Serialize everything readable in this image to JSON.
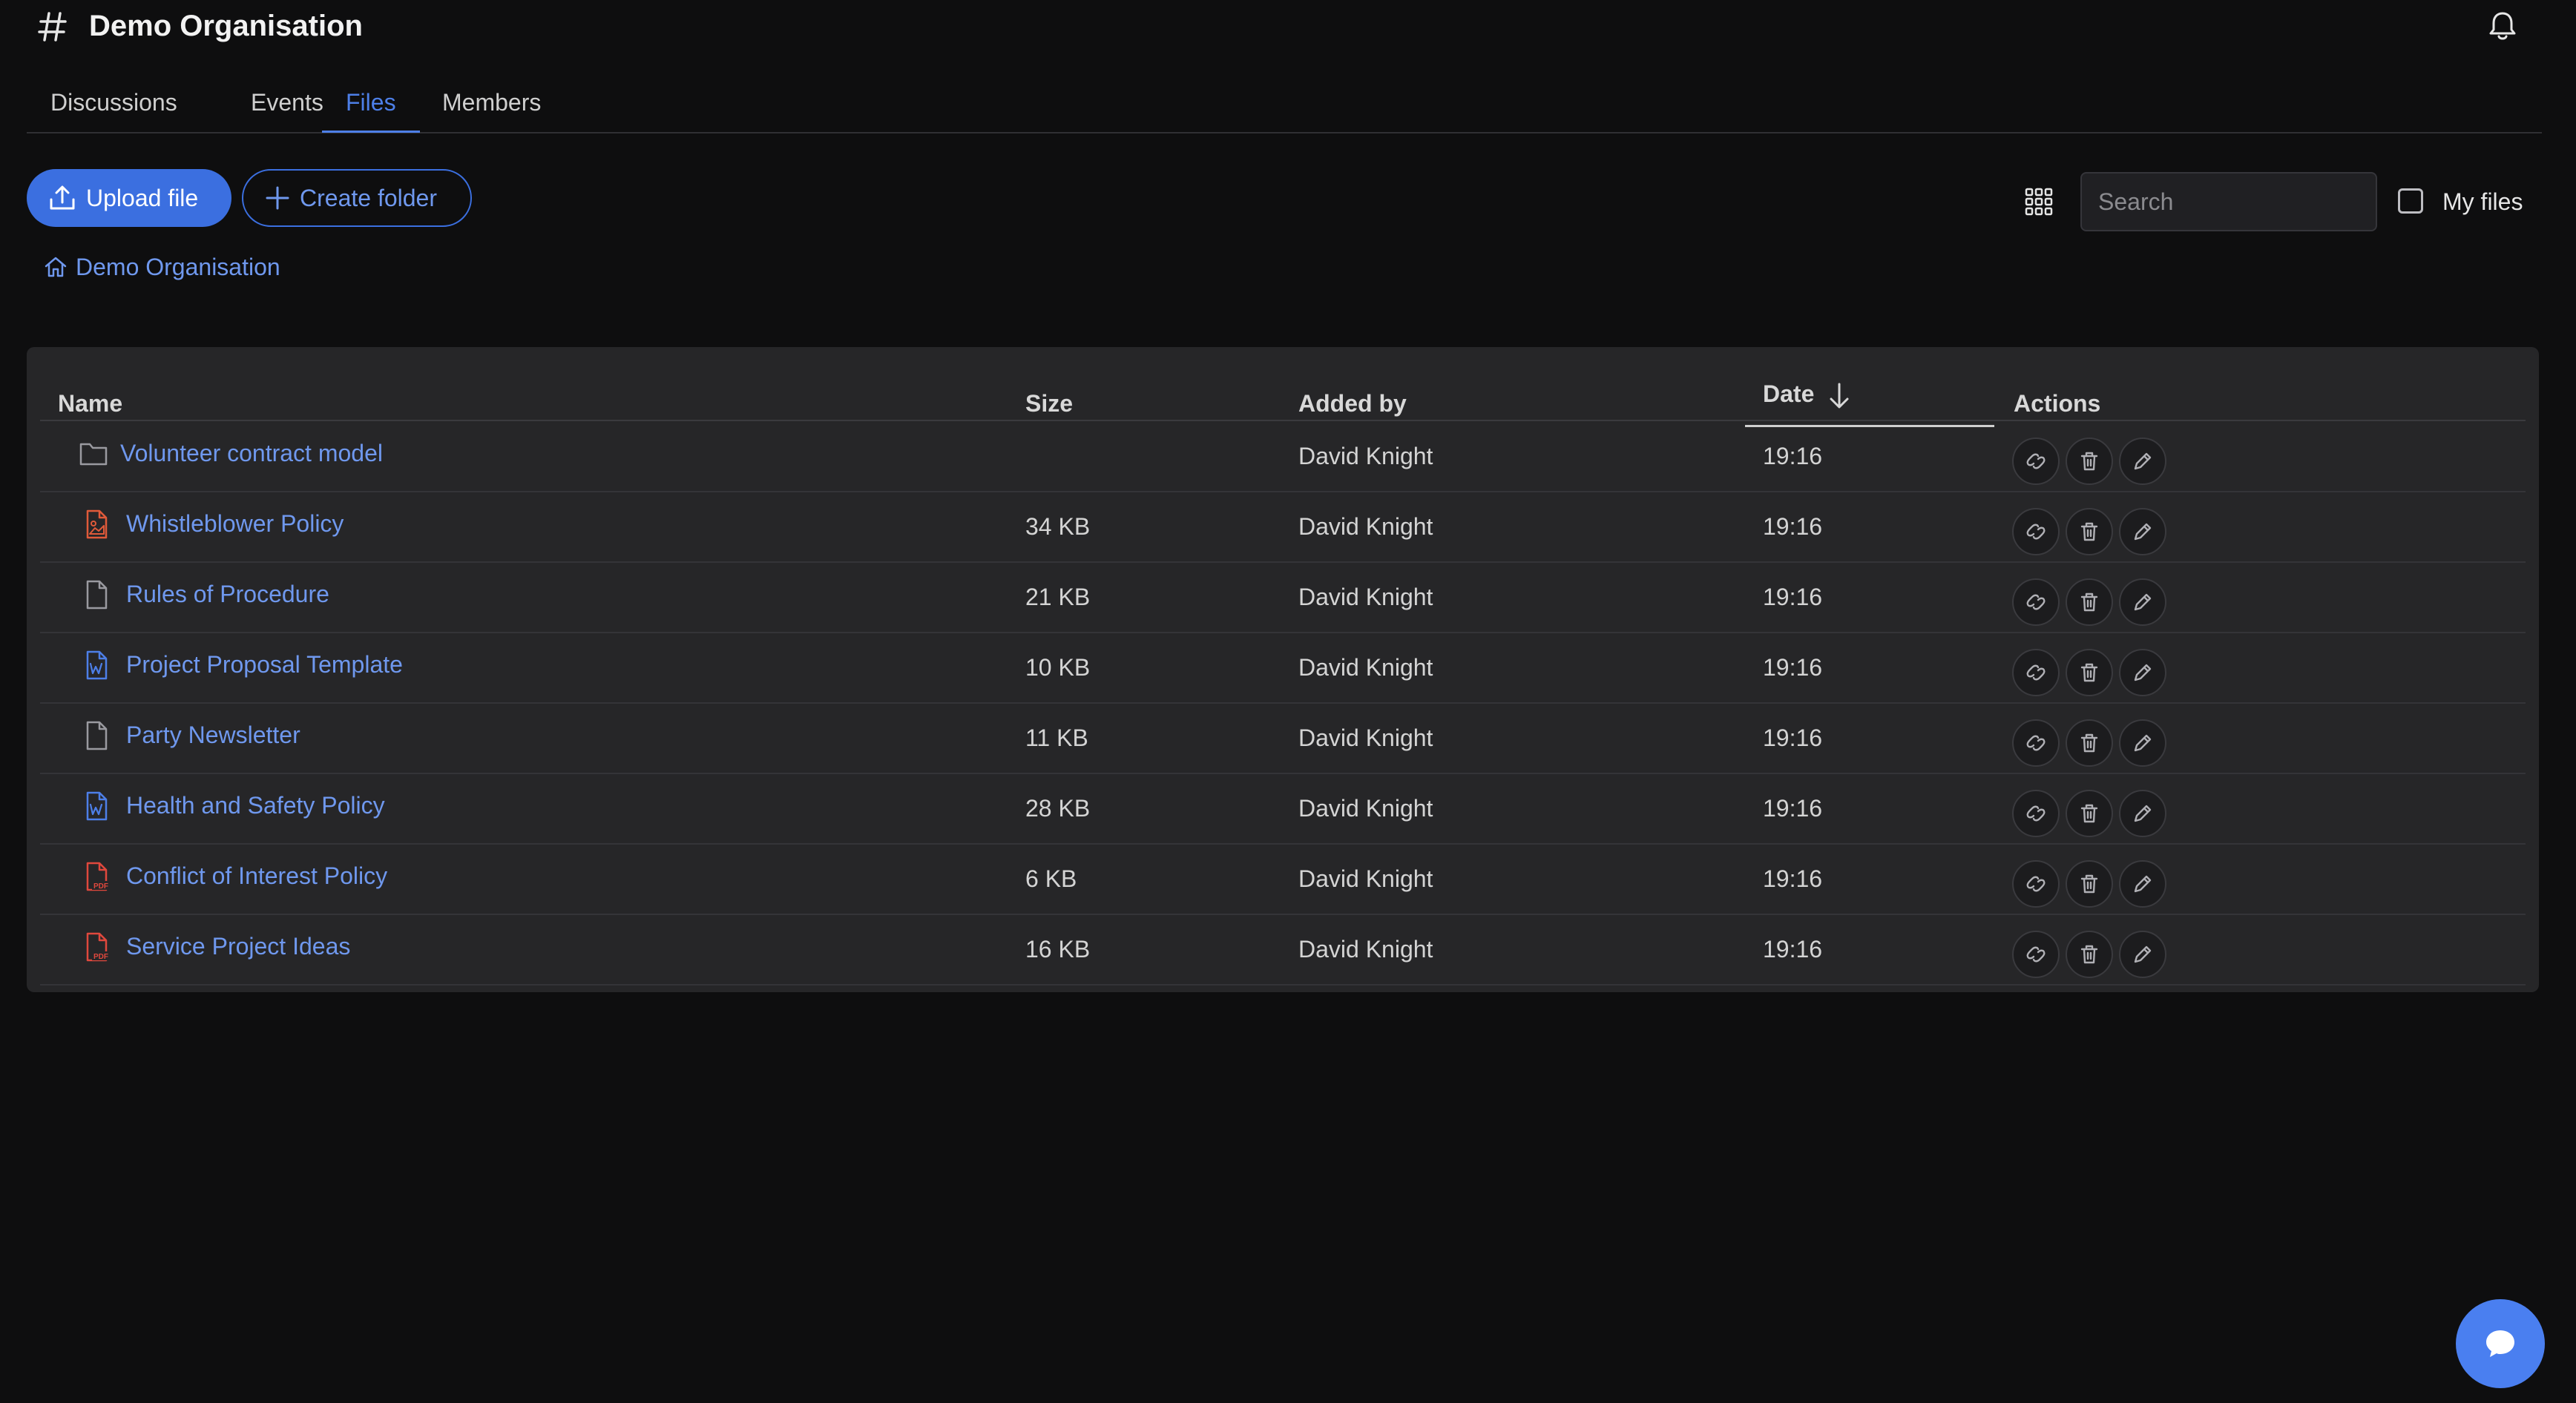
{
  "header": {
    "title": "Demo Organisation",
    "hash_icon": "hash-icon",
    "bell_icon": "bell-icon"
  },
  "tabs": [
    {
      "label": "Discussions",
      "active": false
    },
    {
      "label": "Events",
      "active": false
    },
    {
      "label": "Files",
      "active": true
    },
    {
      "label": "Members",
      "active": false
    }
  ],
  "toolbar": {
    "upload_label": "Upload file",
    "create_folder_label": "Create folder",
    "search_placeholder": "Search",
    "my_files_label": "My files",
    "my_files_checked": false
  },
  "breadcrumb": {
    "home_label": "Demo Organisation",
    "icon": "home-icon"
  },
  "table": {
    "columns": {
      "name": "Name",
      "size": "Size",
      "added_by": "Added by",
      "date": "Date",
      "actions": "Actions"
    },
    "sort": {
      "column": "date",
      "direction": "desc"
    },
    "rows": [
      {
        "icon": "folder-icon",
        "name": "Volunteer contract model",
        "size": "",
        "added_by": "David Knight",
        "date": "19:16"
      },
      {
        "icon": "image-file-icon",
        "name": "Whistleblower Policy",
        "size": "34 KB",
        "added_by": "David Knight",
        "date": "19:16"
      },
      {
        "icon": "document-icon",
        "name": "Rules of Procedure",
        "size": "21 KB",
        "added_by": "David Knight",
        "date": "19:16"
      },
      {
        "icon": "word-file-icon",
        "name": "Project Proposal Template",
        "size": "10 KB",
        "added_by": "David Knight",
        "date": "19:16"
      },
      {
        "icon": "document-icon",
        "name": "Party Newsletter",
        "size": "11 KB",
        "added_by": "David Knight",
        "date": "19:16"
      },
      {
        "icon": "word-file-icon",
        "name": "Health and Safety Policy",
        "size": "28 KB",
        "added_by": "David Knight",
        "date": "19:16"
      },
      {
        "icon": "pdf-file-icon",
        "name": "Conflict of Interest Policy",
        "size": "6 KB",
        "added_by": "David Knight",
        "date": "19:16"
      },
      {
        "icon": "pdf-file-icon",
        "name": "Service Project Ideas",
        "size": "16 KB",
        "added_by": "David Knight",
        "date": "19:16"
      }
    ],
    "action_icons": [
      "link-icon",
      "trash-icon",
      "pencil-icon"
    ]
  },
  "colors": {
    "accent": "#3b6fe0",
    "link": "#6f98ee",
    "background": "#0e0e0f",
    "card": "#262628",
    "pdf": "#e0483d",
    "image": "#e05a3a",
    "word": "#4d7fe8"
  },
  "chat": {
    "icon": "chat-bubble-icon"
  }
}
